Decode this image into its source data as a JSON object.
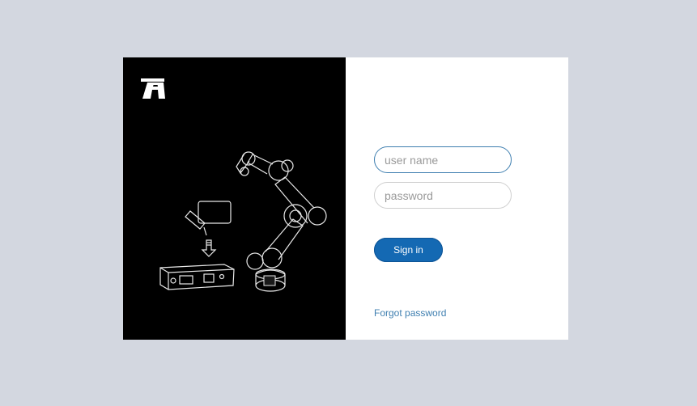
{
  "login": {
    "username_placeholder": "user name",
    "password_placeholder": "password",
    "signin_label": "Sign in",
    "forgot_label": "Forgot password"
  },
  "colors": {
    "page_background": "#d3d7e0",
    "art_background": "#000000",
    "accent": "#1469b3",
    "link": "#3f7fb0"
  },
  "icons": {
    "logo": "brand-logo-icon",
    "illustration": "robot-arm-control-box-illustration"
  }
}
